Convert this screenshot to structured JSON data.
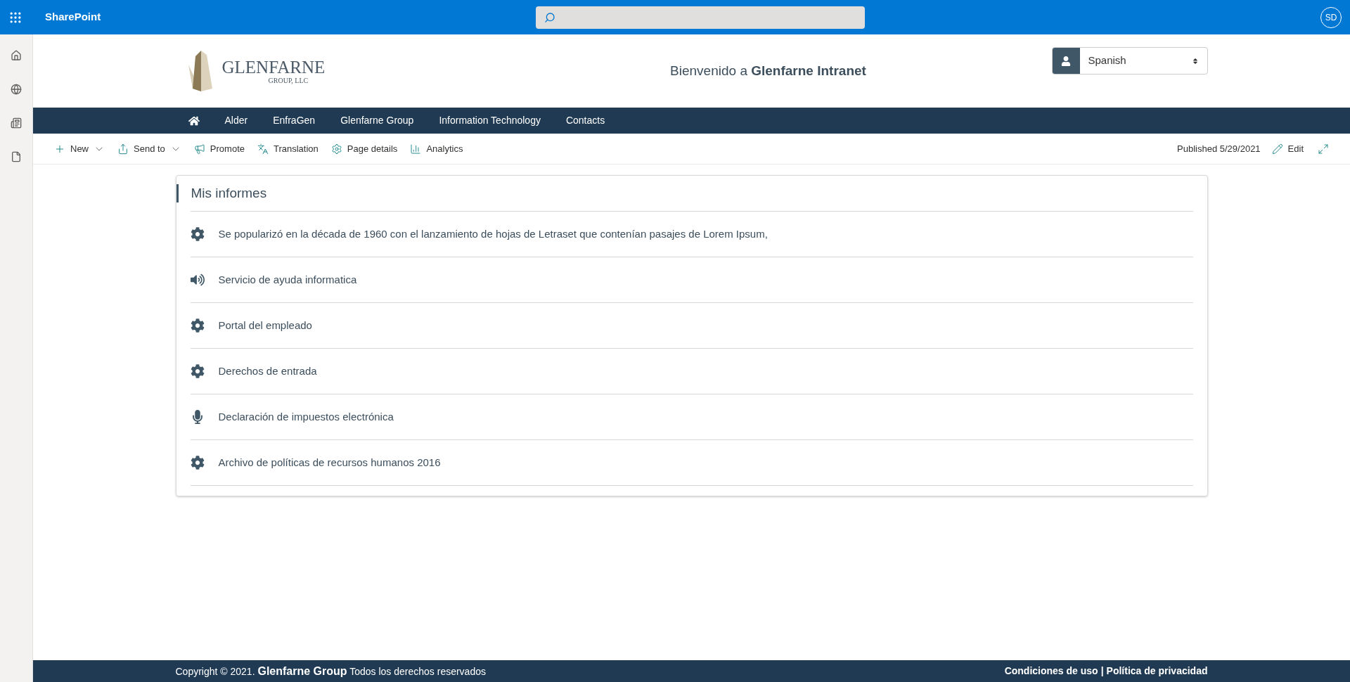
{
  "suite_bar": {
    "app_name": "SharePoint",
    "avatar": "SD"
  },
  "header": {
    "logo": {
      "name": "GLENFARNE",
      "sub": "GROUP, LLC"
    },
    "welcome": "Bienvenido a **Glenfarne Intranet**",
    "language": {
      "value": "Spanish"
    }
  },
  "nav": {
    "items": [
      "Alder",
      "EnfraGen",
      "Glenfarne Group",
      "Information Technology",
      "Contacts"
    ]
  },
  "command_bar": {
    "items": [
      {
        "label": "New",
        "kind": "new",
        "menu": true
      },
      {
        "label": "Send to",
        "kind": "share",
        "menu": true
      },
      {
        "label": "Promote",
        "kind": "promote",
        "menu": false
      },
      {
        "label": "Translation",
        "kind": "translate",
        "menu": false
      },
      {
        "label": "Page details",
        "kind": "settings",
        "menu": false
      },
      {
        "label": "Analytics",
        "kind": "analytics",
        "menu": false
      }
    ],
    "published": "Published 5/29/2021",
    "edit": "Edit"
  },
  "reports": {
    "title": "Mis informes",
    "items": [
      {
        "label": "Se popularizó en la década de 1960 con el lanzamiento de hojas de Letraset que contenían pasajes de Lorem Ipsum,",
        "kind": "gear"
      },
      {
        "label": "Servicio de ayuda informatica",
        "kind": "speaker"
      },
      {
        "label": "Portal del empleado",
        "kind": "gear"
      },
      {
        "label": "Derechos de entrada",
        "kind": "gear"
      },
      {
        "label": "Declaración de impuestos electrónica",
        "kind": "microphone"
      },
      {
        "label": "Archivo de políticas de recursos humanos 2016",
        "kind": "gear"
      }
    ]
  },
  "footer": {
    "copyright": "Copyright © 2021. **Glenfarne Group** Todos los derechos reservados",
    "links": [
      "Condiciones de uso",
      "Política de privacidad"
    ],
    "separator": "|"
  }
}
